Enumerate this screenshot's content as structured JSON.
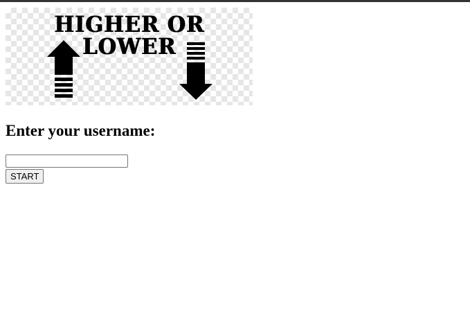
{
  "logo": {
    "title": "HIGHER OR LOWER",
    "up_arrow_icon": "arrow-up-icon",
    "down_arrow_icon": "arrow-down-icon"
  },
  "form": {
    "prompt": "Enter your username:",
    "username_value": "",
    "start_label": "START"
  },
  "colors": {
    "top_bar": "#333333",
    "text": "#000000",
    "button_bg": "#efefef"
  }
}
